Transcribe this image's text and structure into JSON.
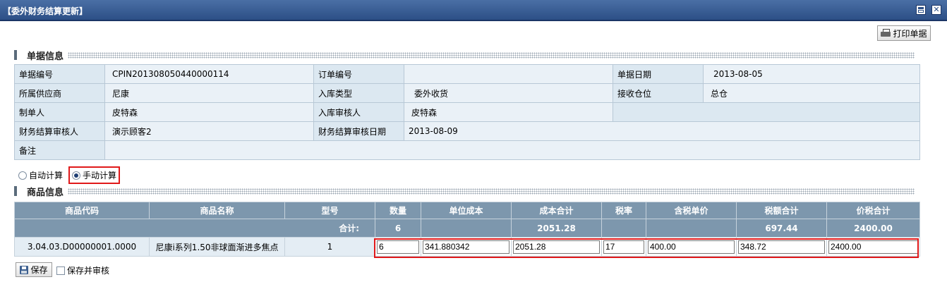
{
  "window": {
    "title": "【委外财务结算更新】",
    "close_glyph": "✕"
  },
  "toolbar": {
    "print_label": "打印单据"
  },
  "bill_section": {
    "title": "单据信息"
  },
  "bill_info": {
    "bill_no_label": "单据编号",
    "bill_no": "CPIN201308050440000114",
    "order_no_label": "订单编号",
    "order_no": "",
    "bill_date_label": "单据日期",
    "bill_date": "2013-08-05",
    "supplier_label": "所属供应商",
    "supplier": "尼康",
    "stockin_type_label": "入库类型",
    "stockin_type": "委外收货",
    "warehouse_label": "接收仓位",
    "warehouse": "总仓",
    "creator_label": "制单人",
    "creator": "皮特森",
    "stockin_auditor_label": "入库审核人",
    "stockin_auditor": "皮特森",
    "fin_auditor_label": "财务结算审核人",
    "fin_auditor": "演示顾客2",
    "fin_audit_date_label": "财务结算审核日期",
    "fin_audit_date": "2013-08-09",
    "remark_label": "备注",
    "remark": ""
  },
  "calc_mode": {
    "auto_label": "自动计算",
    "manual_label": "手动计算",
    "selected": "manual"
  },
  "goods_section": {
    "title": "商品信息"
  },
  "goods_table": {
    "headers": [
      "商品代码",
      "商品名称",
      "型号",
      "数量",
      "单位成本",
      "成本合计",
      "税率",
      "含税单价",
      "税额合计",
      "价税合计"
    ],
    "sum": {
      "label": "合计:",
      "qty": "6",
      "cost_total": "2051.28",
      "tax_total": "697.44",
      "price_tax_total": "2400.00"
    },
    "row": {
      "code": "3.04.03.D00000001.0000",
      "name": "尼康i系列1.50非球面渐进多焦点",
      "model": "1",
      "qty": "6",
      "unit_cost": "341.880342",
      "cost_total": "2051.28",
      "tax_rate": "17",
      "unit_price_tax": "400.00",
      "tax_amount": "348.72",
      "price_tax_total": "2400.00"
    }
  },
  "actions": {
    "save_label": "保存",
    "save_audit_label": "保存并审核"
  },
  "colors": {
    "titlebar": "#2c4f86",
    "header": "#7d97ad",
    "highlight": "#e0191a"
  }
}
